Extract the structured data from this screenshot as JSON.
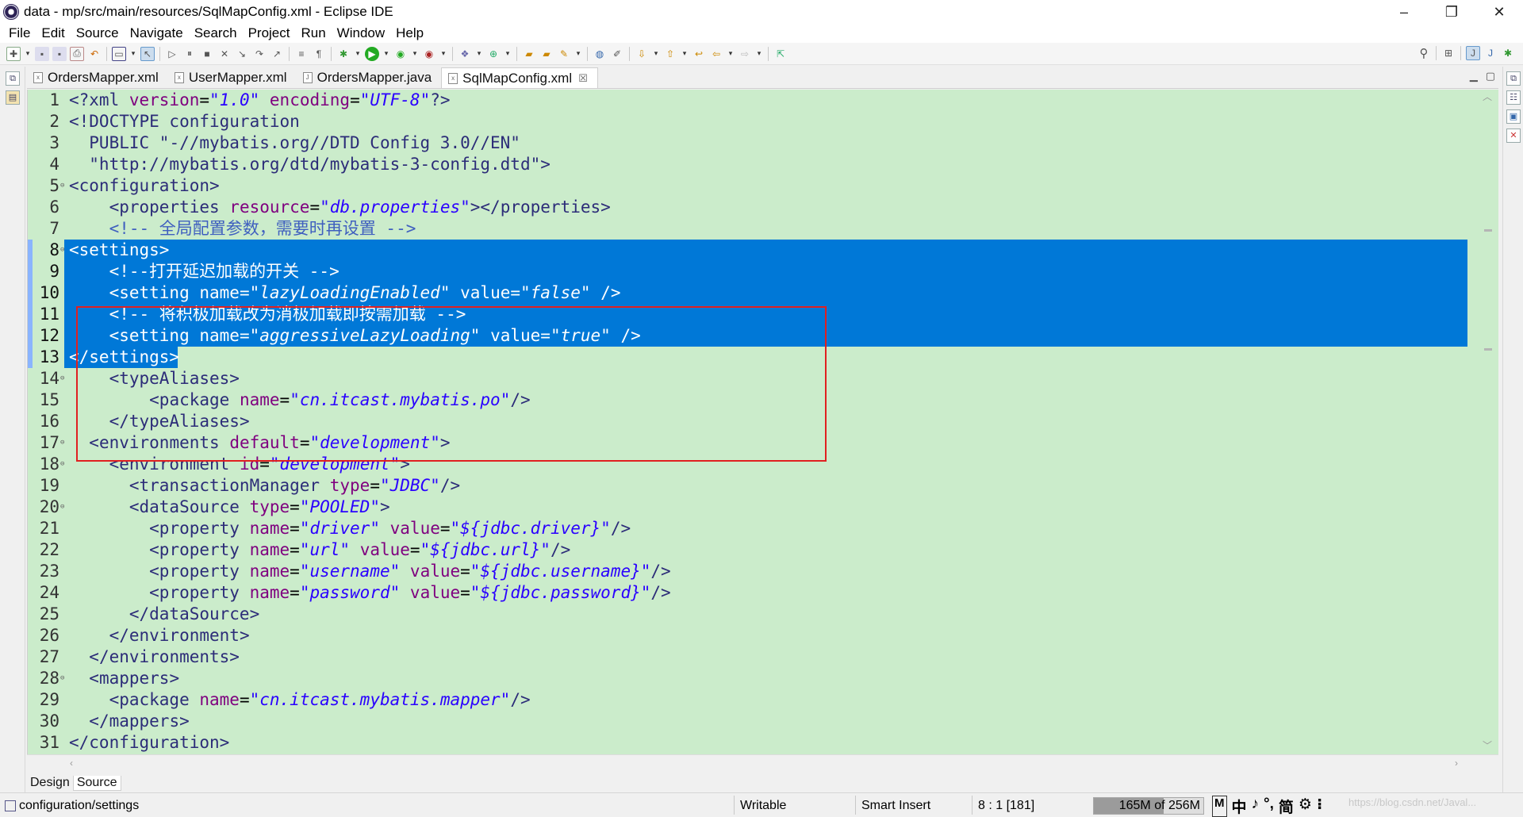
{
  "window": {
    "title": "data - mp/src/main/resources/SqlMapConfig.xml - Eclipse IDE",
    "controls": {
      "minimize": "–",
      "restore": "❐",
      "close": "✕"
    }
  },
  "menu": [
    "File",
    "Edit",
    "Source",
    "Navigate",
    "Search",
    "Project",
    "Run",
    "Window",
    "Help"
  ],
  "tabs": [
    {
      "label": "OrdersMapper.xml",
      "icon": "xml-file-icon",
      "active": false
    },
    {
      "label": "UserMapper.xml",
      "icon": "xml-file-icon",
      "active": false
    },
    {
      "label": "OrdersMapper.java",
      "icon": "java-file-icon",
      "active": false
    },
    {
      "label": "SqlMapConfig.xml",
      "icon": "xml-file-icon",
      "active": true,
      "close": "☒"
    }
  ],
  "editor": {
    "lines": [
      {
        "n": "1",
        "fold": "",
        "sel": false,
        "parts": [
          [
            "pi",
            "<?xml "
          ],
          [
            "attr",
            "version"
          ],
          [
            "plain",
            "="
          ],
          [
            "str",
            "\"1.0\""
          ],
          [
            "plain",
            " "
          ],
          [
            "attr",
            "encoding"
          ],
          [
            "plain",
            "="
          ],
          [
            "str",
            "\"UTF-8\""
          ],
          [
            "pi",
            "?>"
          ]
        ]
      },
      {
        "n": "2",
        "fold": "",
        "sel": false,
        "parts": [
          [
            "tag",
            "<!DOCTYPE configuration"
          ]
        ]
      },
      {
        "n": "3",
        "fold": "",
        "sel": false,
        "parts": [
          [
            "tag",
            "  PUBLIC "
          ],
          [
            "tag",
            "\"-//mybatis.org//DTD Config 3.0//EN\""
          ]
        ]
      },
      {
        "n": "4",
        "fold": "",
        "sel": false,
        "parts": [
          [
            "tag",
            "  \"http://mybatis.org/dtd/mybatis-3-config.dtd\">"
          ]
        ]
      },
      {
        "n": "5",
        "fold": "⊖",
        "sel": false,
        "parts": [
          [
            "tag",
            "<configuration>"
          ]
        ]
      },
      {
        "n": "6",
        "fold": "",
        "sel": false,
        "parts": [
          [
            "plain",
            "    "
          ],
          [
            "tag",
            "<properties "
          ],
          [
            "attr",
            "resource"
          ],
          [
            "plain",
            "="
          ],
          [
            "str",
            "\"db.properties\""
          ],
          [
            "tag",
            "></properties>"
          ]
        ]
      },
      {
        "n": "7",
        "fold": "",
        "sel": false,
        "parts": [
          [
            "plain",
            "    "
          ],
          [
            "cmt",
            "<!-- 全局配置参数，需要时再设置 -->"
          ]
        ]
      },
      {
        "n": "8",
        "fold": "⊖",
        "sel": true,
        "parts": [
          [
            "tag",
            "<settings>"
          ]
        ]
      },
      {
        "n": "9",
        "fold": "",
        "sel": true,
        "parts": [
          [
            "plain",
            "    "
          ],
          [
            "cmt",
            "<!--打开延迟加载的开关 -->"
          ]
        ]
      },
      {
        "n": "10",
        "fold": "",
        "sel": true,
        "parts": [
          [
            "plain",
            "    "
          ],
          [
            "tag",
            "<setting "
          ],
          [
            "attr",
            "name"
          ],
          [
            "plain",
            "="
          ],
          [
            "str",
            "\"lazyLoadingEnabled\""
          ],
          [
            "plain",
            " "
          ],
          [
            "attr",
            "value"
          ],
          [
            "plain",
            "="
          ],
          [
            "str",
            "\"false\""
          ],
          [
            "tag",
            " />"
          ]
        ]
      },
      {
        "n": "11",
        "fold": "",
        "sel": true,
        "parts": [
          [
            "plain",
            "    "
          ],
          [
            "cmt",
            "<!-- 将积极加载改为消极加载即按需加载 -->"
          ]
        ]
      },
      {
        "n": "12",
        "fold": "",
        "sel": true,
        "parts": [
          [
            "plain",
            "    "
          ],
          [
            "tag",
            "<setting "
          ],
          [
            "attr",
            "name"
          ],
          [
            "plain",
            "="
          ],
          [
            "str",
            "\"aggressiveLazyLoading\""
          ],
          [
            "plain",
            " "
          ],
          [
            "attr",
            "value"
          ],
          [
            "plain",
            "="
          ],
          [
            "str",
            "\"true\""
          ],
          [
            "tag",
            " />"
          ]
        ]
      },
      {
        "n": "13",
        "fold": "",
        "sel": "partial",
        "parts": [
          [
            "tag",
            "</settings>"
          ]
        ]
      },
      {
        "n": "14",
        "fold": "⊖",
        "sel": false,
        "parts": [
          [
            "plain",
            "    "
          ],
          [
            "tag",
            "<typeAliases>"
          ]
        ]
      },
      {
        "n": "15",
        "fold": "",
        "sel": false,
        "parts": [
          [
            "plain",
            "        "
          ],
          [
            "tag",
            "<package "
          ],
          [
            "attr",
            "name"
          ],
          [
            "plain",
            "="
          ],
          [
            "str",
            "\"cn.itcast.mybatis.po\""
          ],
          [
            "tag",
            "/>"
          ]
        ]
      },
      {
        "n": "16",
        "fold": "",
        "sel": false,
        "parts": [
          [
            "plain",
            "    "
          ],
          [
            "tag",
            "</typeAliases>"
          ]
        ]
      },
      {
        "n": "17",
        "fold": "⊖",
        "sel": false,
        "parts": [
          [
            "plain",
            "  "
          ],
          [
            "tag",
            "<environments "
          ],
          [
            "attr",
            "default"
          ],
          [
            "plain",
            "="
          ],
          [
            "str",
            "\"development\""
          ],
          [
            "tag",
            ">"
          ]
        ]
      },
      {
        "n": "18",
        "fold": "⊖",
        "sel": false,
        "parts": [
          [
            "plain",
            "    "
          ],
          [
            "tag",
            "<environment "
          ],
          [
            "attr",
            "id"
          ],
          [
            "plain",
            "="
          ],
          [
            "str",
            "\"development\""
          ],
          [
            "tag",
            ">"
          ]
        ]
      },
      {
        "n": "19",
        "fold": "",
        "sel": false,
        "parts": [
          [
            "plain",
            "      "
          ],
          [
            "tag",
            "<transactionManager "
          ],
          [
            "attr",
            "type"
          ],
          [
            "plain",
            "="
          ],
          [
            "str",
            "\"JDBC\""
          ],
          [
            "tag",
            "/>"
          ]
        ]
      },
      {
        "n": "20",
        "fold": "⊖",
        "sel": false,
        "parts": [
          [
            "plain",
            "      "
          ],
          [
            "tag",
            "<dataSource "
          ],
          [
            "attr",
            "type"
          ],
          [
            "plain",
            "="
          ],
          [
            "str",
            "\"POOLED\""
          ],
          [
            "tag",
            ">"
          ]
        ]
      },
      {
        "n": "21",
        "fold": "",
        "sel": false,
        "parts": [
          [
            "plain",
            "        "
          ],
          [
            "tag",
            "<property "
          ],
          [
            "attr",
            "name"
          ],
          [
            "plain",
            "="
          ],
          [
            "str",
            "\"driver\""
          ],
          [
            "plain",
            " "
          ],
          [
            "attr",
            "value"
          ],
          [
            "plain",
            "="
          ],
          [
            "str",
            "\"${jdbc.driver}\""
          ],
          [
            "tag",
            "/>"
          ]
        ]
      },
      {
        "n": "22",
        "fold": "",
        "sel": false,
        "parts": [
          [
            "plain",
            "        "
          ],
          [
            "tag",
            "<property "
          ],
          [
            "attr",
            "name"
          ],
          [
            "plain",
            "="
          ],
          [
            "str",
            "\"url\""
          ],
          [
            "plain",
            " "
          ],
          [
            "attr",
            "value"
          ],
          [
            "plain",
            "="
          ],
          [
            "str",
            "\"${jdbc.url}\""
          ],
          [
            "tag",
            "/>"
          ]
        ]
      },
      {
        "n": "23",
        "fold": "",
        "sel": false,
        "parts": [
          [
            "plain",
            "        "
          ],
          [
            "tag",
            "<property "
          ],
          [
            "attr",
            "name"
          ],
          [
            "plain",
            "="
          ],
          [
            "str",
            "\"username\""
          ],
          [
            "plain",
            " "
          ],
          [
            "attr",
            "value"
          ],
          [
            "plain",
            "="
          ],
          [
            "str",
            "\"${jdbc.username}\""
          ],
          [
            "tag",
            "/>"
          ]
        ]
      },
      {
        "n": "24",
        "fold": "",
        "sel": false,
        "parts": [
          [
            "plain",
            "        "
          ],
          [
            "tag",
            "<property "
          ],
          [
            "attr",
            "name"
          ],
          [
            "plain",
            "="
          ],
          [
            "str",
            "\"password\""
          ],
          [
            "plain",
            " "
          ],
          [
            "attr",
            "value"
          ],
          [
            "plain",
            "="
          ],
          [
            "str",
            "\"${jdbc.password}\""
          ],
          [
            "tag",
            "/>"
          ]
        ]
      },
      {
        "n": "25",
        "fold": "",
        "sel": false,
        "parts": [
          [
            "plain",
            "      "
          ],
          [
            "tag",
            "</dataSource>"
          ]
        ]
      },
      {
        "n": "26",
        "fold": "",
        "sel": false,
        "parts": [
          [
            "plain",
            "    "
          ],
          [
            "tag",
            "</environment>"
          ]
        ]
      },
      {
        "n": "27",
        "fold": "",
        "sel": false,
        "parts": [
          [
            "plain",
            "  "
          ],
          [
            "tag",
            "</environments>"
          ]
        ]
      },
      {
        "n": "28",
        "fold": "⊖",
        "sel": false,
        "parts": [
          [
            "plain",
            "  "
          ],
          [
            "tag",
            "<mappers>"
          ]
        ]
      },
      {
        "n": "29",
        "fold": "",
        "sel": false,
        "parts": [
          [
            "plain",
            "    "
          ],
          [
            "tag",
            "<package "
          ],
          [
            "attr",
            "name"
          ],
          [
            "plain",
            "="
          ],
          [
            "str",
            "\"cn.itcast.mybatis.mapper\""
          ],
          [
            "tag",
            "/>"
          ]
        ]
      },
      {
        "n": "30",
        "fold": "",
        "sel": false,
        "parts": [
          [
            "plain",
            "  "
          ],
          [
            "tag",
            "</mappers>"
          ]
        ]
      },
      {
        "n": "31",
        "fold": "",
        "sel": false,
        "parts": [
          [
            "tag",
            "</configuration>"
          ]
        ]
      }
    ]
  },
  "bottom_tabs": [
    {
      "label": "Design",
      "active": false
    },
    {
      "label": "Source",
      "active": true
    }
  ],
  "status": {
    "breadcrumb": "configuration/settings",
    "writable": "Writable",
    "insert_mode": "Smart Insert",
    "cursor": "8 : 1 [181]",
    "heap": "165M of 256M",
    "heap_fraction": 0.64,
    "ime": [
      "M",
      "中",
      "♪",
      "°,",
      "简",
      "⚙",
      "⁝"
    ],
    "watermark": "https://blog.csdn.net/Javal..."
  },
  "colors": {
    "editor_bg": "#cbeccb",
    "selection": "#0078d7",
    "annotation_box": "#e02020"
  }
}
